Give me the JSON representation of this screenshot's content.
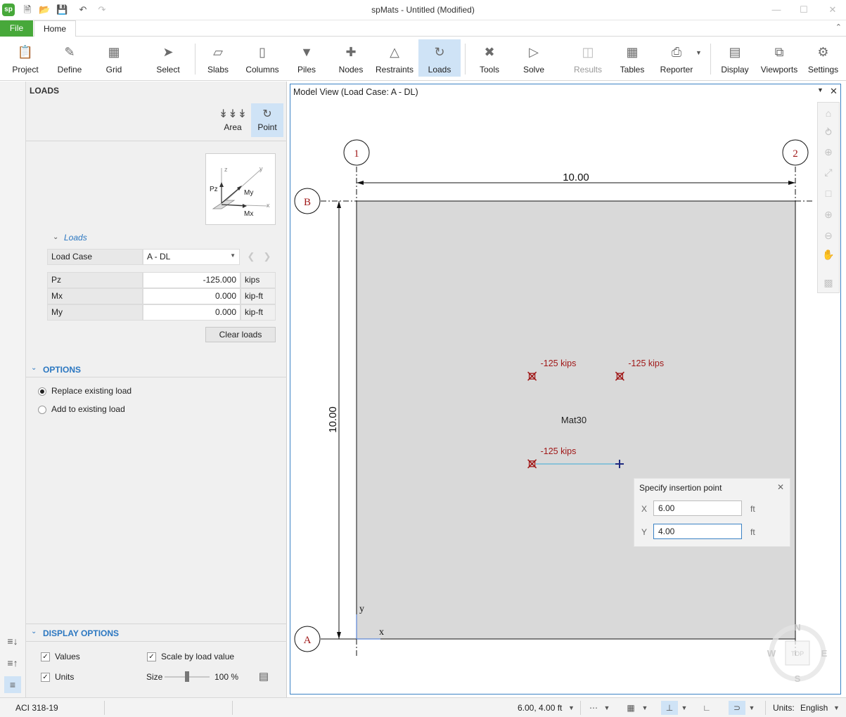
{
  "app": {
    "logo": "sp",
    "title": "spMats - Untitled (Modified)"
  },
  "quick_access": {
    "icons": [
      "new-file-icon",
      "open-folder-icon",
      "save-icon",
      "undo-icon",
      "redo-icon"
    ]
  },
  "menu": {
    "file": "File",
    "home": "Home"
  },
  "ribbon": {
    "buttons": [
      {
        "label": "Project",
        "icon": "project-icon"
      },
      {
        "label": "Define",
        "icon": "define-icon"
      },
      {
        "label": "Grid",
        "icon": "grid-icon"
      },
      {
        "label": "Select",
        "icon": "cursor-icon"
      },
      {
        "label": "Slabs",
        "icon": "slab-icon"
      },
      {
        "label": "Columns",
        "icon": "column-icon"
      },
      {
        "label": "Piles",
        "icon": "pile-icon"
      },
      {
        "label": "Nodes",
        "icon": "node-icon"
      },
      {
        "label": "Restraints",
        "icon": "restraint-icon"
      },
      {
        "label": "Loads",
        "icon": "load-icon",
        "active": true
      },
      {
        "label": "Tools",
        "icon": "tools-icon"
      },
      {
        "label": "Solve",
        "icon": "solve-icon"
      },
      {
        "label": "Results",
        "icon": "results-icon",
        "disabled": true
      },
      {
        "label": "Tables",
        "icon": "tables-icon"
      },
      {
        "label": "Reporter",
        "icon": "printer-icon"
      },
      {
        "label": "Display",
        "icon": "display-icon"
      },
      {
        "label": "Viewports",
        "icon": "viewports-icon"
      },
      {
        "label": "Settings",
        "icon": "gear-icon"
      }
    ]
  },
  "panel": {
    "title": "LOADS",
    "load_types": {
      "area": "Area",
      "point": "Point"
    },
    "diagram": {
      "z": "z",
      "y": "y",
      "x": "x",
      "pz": "Pz",
      "my": "My",
      "mx": "Mx"
    },
    "loads_section": "Loads",
    "load_case_label": "Load Case",
    "load_case_value": "A - DL",
    "rows": [
      {
        "name": "Pz",
        "value": "-125.000",
        "unit": "kips"
      },
      {
        "name": "Mx",
        "value": "0.000",
        "unit": "kip-ft"
      },
      {
        "name": "My",
        "value": "0.000",
        "unit": "kip-ft"
      }
    ],
    "clear_loads": "Clear loads",
    "options_title": "OPTIONS",
    "replace_existing": "Replace existing load",
    "add_existing": "Add to existing load",
    "display_options_title": "DISPLAY OPTIONS",
    "values_label": "Values",
    "units_label": "Units",
    "scale_label": "Scale by load value",
    "size_label": "Size",
    "size_value": "100 %",
    "size_fraction": 0.5
  },
  "model_view": {
    "title": "Model View (Load Case: A - DL)",
    "grid_labels": {
      "col1": "1",
      "col2": "2",
      "rowA": "A",
      "rowB": "B"
    },
    "dim_horizontal": "10.00",
    "dim_vertical": "10.00",
    "slab_label": "Mat30",
    "loads": [
      {
        "label": "-125 kips",
        "x": 4,
        "y": 6
      },
      {
        "label": "-125 kips",
        "x": 6,
        "y": 6
      },
      {
        "label": "-125 kips",
        "x": 4,
        "y": 4
      }
    ],
    "axis": {
      "x": "x",
      "y": "y"
    },
    "compass": {
      "n": "N",
      "s": "S",
      "e": "E",
      "w": "W",
      "top": "TOP"
    },
    "colors": {
      "load": "#a01818",
      "slab": "#d9d9d9",
      "grid_bubble": "#a01818",
      "accent": "#3b82c4"
    }
  },
  "insertion": {
    "title": "Specify insertion point",
    "x_label": "X",
    "x_value": "6.00",
    "x_unit": "ft",
    "y_label": "Y",
    "y_value": "4.00",
    "y_unit": "ft"
  },
  "status": {
    "code": "ACI 318-19",
    "coords": "6.00, 4.00 ft",
    "units_label": "Units:",
    "units_value": "English"
  }
}
